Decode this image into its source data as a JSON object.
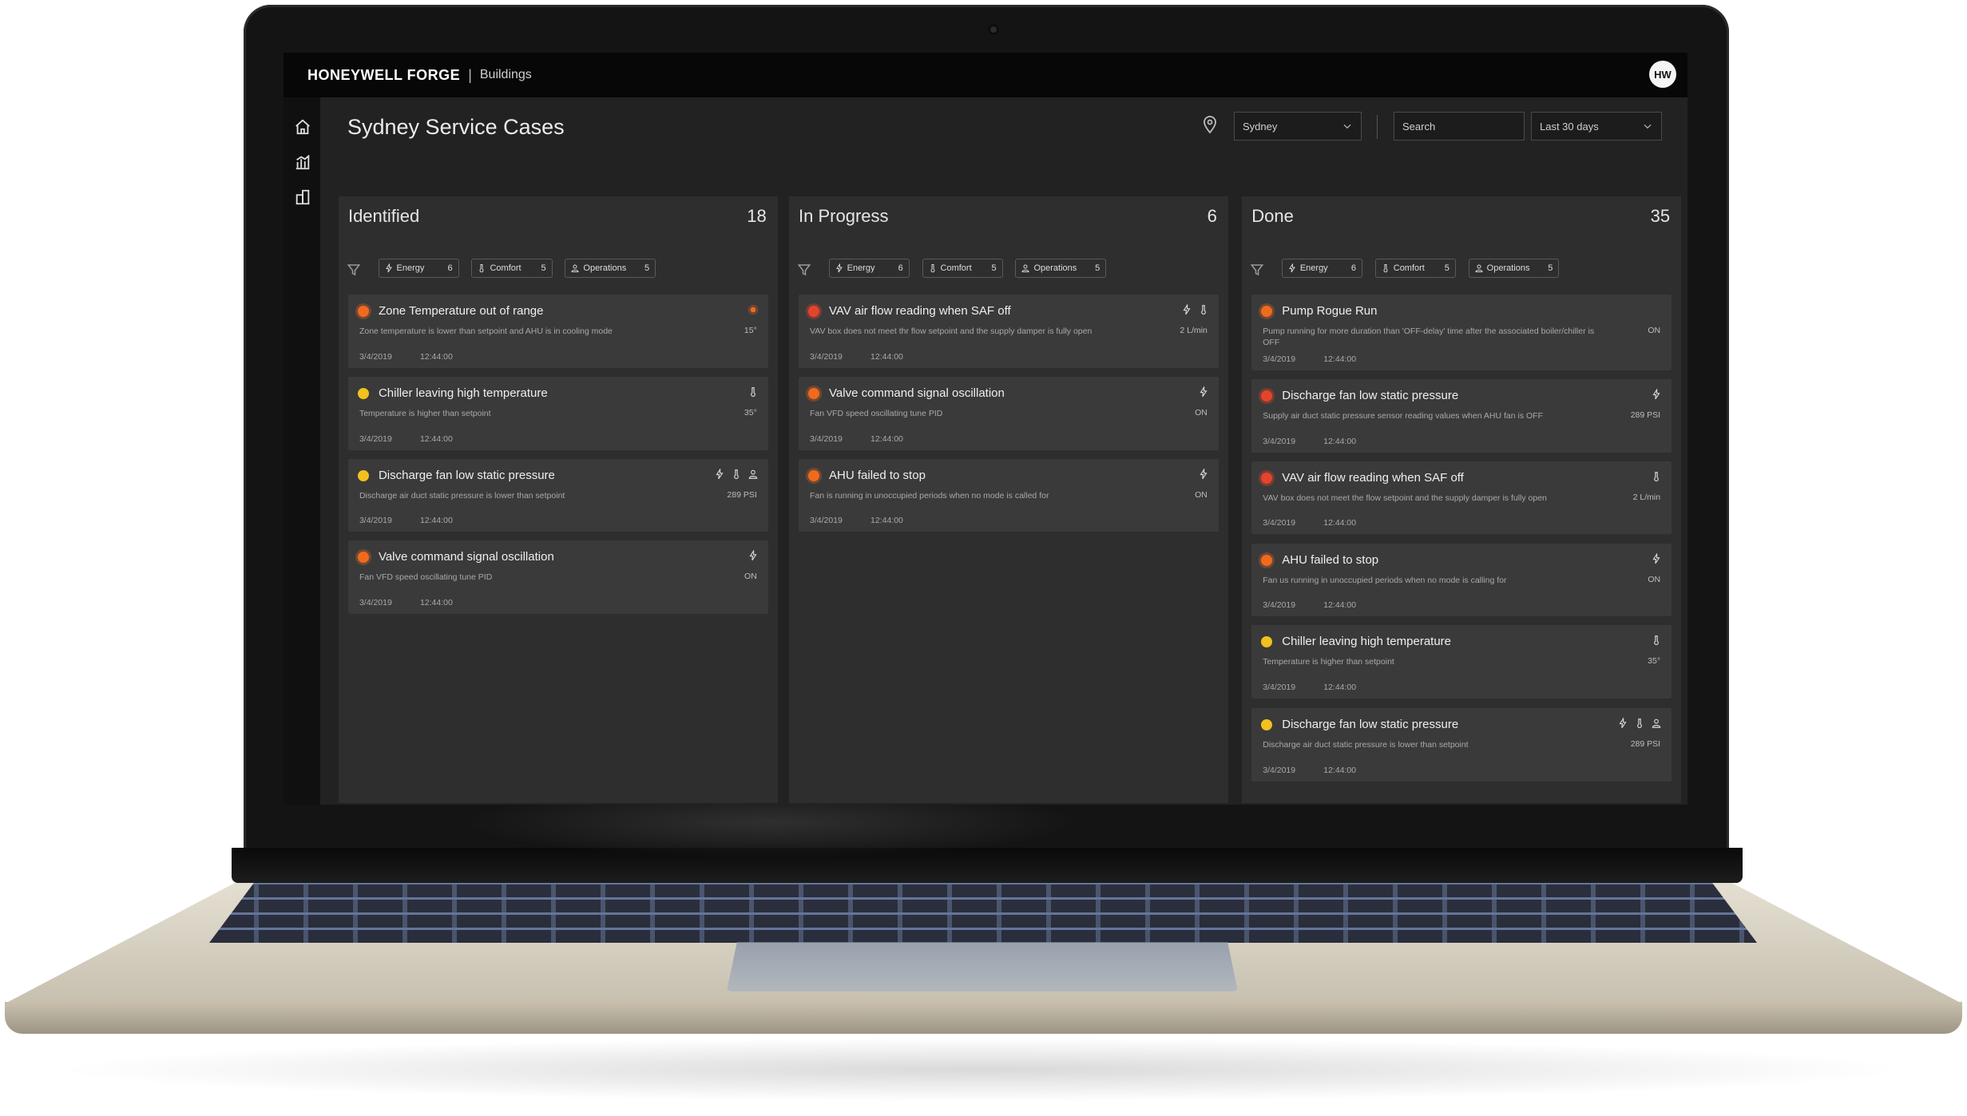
{
  "app": {
    "brand": "HONEYWELL FORGE",
    "separator": "|",
    "product": "Buildings",
    "avatar": "HW"
  },
  "nav": [
    "home-icon",
    "analytics-icon",
    "buildings-icon"
  ],
  "page": {
    "title": "Sydney Service Cases",
    "location_select": "Sydney",
    "search_placeholder": "Search",
    "range_select": "Last 30 days"
  },
  "colors": {
    "red": "#e4442c",
    "orange": "#f06a1e",
    "yellow": "#f2c11e"
  },
  "columns": [
    {
      "title": "Identified",
      "count": "18",
      "filters": [
        {
          "label": "Energy",
          "count": "6",
          "icon": "bolt-icon"
        },
        {
          "label": "Comfort",
          "count": "5",
          "icon": "thermometer-icon"
        },
        {
          "label": "Operations",
          "count": "5",
          "icon": "person-icon"
        }
      ],
      "cards": [
        {
          "title": "Zone Temperature out of range",
          "desc": "Zone temperature is lower than setpoint and AHU is in cooling mode",
          "value": "15°",
          "date": "3/4/2019",
          "time": "12:44:00",
          "status": "orange",
          "icons": [
            "alert-dot-icon"
          ]
        },
        {
          "title": "Chiller leaving high temperature",
          "desc": "Temperature is higher than setpoint",
          "value": "35°",
          "date": "3/4/2019",
          "time": "12:44:00",
          "status": "yellow",
          "icons": [
            "thermometer-icon"
          ]
        },
        {
          "title": "Discharge fan low static pressure",
          "desc": "Discharge air duct static pressure is lower than setpoint",
          "value": "289 PSI",
          "date": "3/4/2019",
          "time": "12:44:00",
          "status": "yellow",
          "icons": [
            "bolt-icon",
            "thermometer-icon",
            "person-icon"
          ]
        },
        {
          "title": "Valve command signal oscillation",
          "desc": "Fan VFD speed oscillating tune PID",
          "value": "ON",
          "date": "3/4/2019",
          "time": "12:44:00",
          "status": "orange",
          "icons": [
            "bolt-icon"
          ]
        }
      ]
    },
    {
      "title": "In Progress",
      "count": "6",
      "filters": [
        {
          "label": "Energy",
          "count": "6",
          "icon": "bolt-icon"
        },
        {
          "label": "Comfort",
          "count": "5",
          "icon": "thermometer-icon"
        },
        {
          "label": "Operations",
          "count": "5",
          "icon": "person-icon"
        }
      ],
      "cards": [
        {
          "title": "VAV air flow reading when SAF off",
          "desc": "VAV box does not meet thr flow setpoint and the supply damper is fully open",
          "value": "2 L/min",
          "date": "3/4/2019",
          "time": "12:44:00",
          "status": "red",
          "icons": [
            "bolt-icon",
            "thermometer-icon"
          ]
        },
        {
          "title": "Valve command signal oscillation",
          "desc": "Fan VFD speed oscillating tune PID",
          "value": "ON",
          "date": "3/4/2019",
          "time": "12:44:00",
          "status": "orange",
          "icons": [
            "bolt-icon"
          ]
        },
        {
          "title": "AHU failed to stop",
          "desc": "Fan is running in unoccupied periods when no mode is called for",
          "value": "ON",
          "date": "3/4/2019",
          "time": "12:44:00",
          "status": "orange",
          "icons": [
            "bolt-icon"
          ]
        }
      ]
    },
    {
      "title": "Done",
      "count": "35",
      "filters": [
        {
          "label": "Energy",
          "count": "6",
          "icon": "bolt-icon"
        },
        {
          "label": "Comfort",
          "count": "5",
          "icon": "thermometer-icon"
        },
        {
          "label": "Operations",
          "count": "5",
          "icon": "person-icon"
        }
      ],
      "cards": [
        {
          "title": "Pump Rogue Run",
          "desc": "Pump running for more duration than 'OFF-delay' time after the associated boiler/chiller is OFF",
          "value": "ON",
          "date": "3/4/2019",
          "time": "12:44:00",
          "status": "orange",
          "icons": []
        },
        {
          "title": "Discharge fan low static pressure",
          "desc": "Supply air duct static pressure sensor reading values when AHU fan is OFF",
          "value": "289 PSI",
          "date": "3/4/2019",
          "time": "12:44:00",
          "status": "red",
          "icons": [
            "bolt-icon"
          ]
        },
        {
          "title": "VAV air flow reading when SAF off",
          "desc": "VAV box does not meet the flow setpoint and the supply damper is fully open",
          "value": "2 L/min",
          "date": "3/4/2019",
          "time": "12:44:00",
          "status": "red",
          "icons": [
            "thermometer-icon"
          ]
        },
        {
          "title": "AHU failed to stop",
          "desc": "Fan us running in unoccupied periods when no mode is calling for",
          "value": "ON",
          "date": "3/4/2019",
          "time": "12:44:00",
          "status": "orange",
          "icons": [
            "bolt-icon"
          ]
        },
        {
          "title": "Chiller leaving high temperature",
          "desc": "Temperature is higher than setpoint",
          "value": "35°",
          "date": "3/4/2019",
          "time": "12:44:00",
          "status": "yellow",
          "icons": [
            "thermometer-icon"
          ]
        },
        {
          "title": "Discharge fan low static pressure",
          "desc": "Discharge air duct static pressure is lower than setpoint",
          "value": "289 PSI",
          "date": "3/4/2019",
          "time": "12:44:00",
          "status": "yellow",
          "icons": [
            "bolt-icon",
            "thermometer-icon",
            "person-icon"
          ]
        }
      ]
    }
  ]
}
